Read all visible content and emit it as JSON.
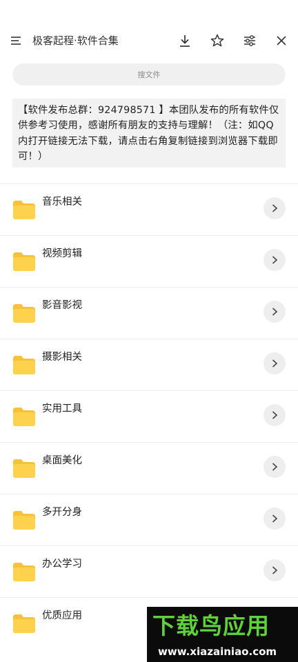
{
  "header": {
    "title": "极客起程·软件合集",
    "icons": {
      "menu": "menu-icon",
      "download": "download-icon",
      "favorite": "star-icon",
      "settings": "sliders-icon",
      "close": "close-icon"
    }
  },
  "search": {
    "placeholder": "搜文件"
  },
  "notice": {
    "text": "【软件发布总群：924798571 】本团队发布的所有软件仅供参考习使用，感谢所有朋友的支持与理解！（注：如QQ内打开链接无法下载，请点击右角复制链接到浏览器下载即可！）"
  },
  "folders": [
    {
      "label": "音乐相关",
      "icon": "folder-icon"
    },
    {
      "label": "视频剪辑",
      "icon": "folder-icon"
    },
    {
      "label": "影音影视",
      "icon": "folder-icon"
    },
    {
      "label": "摄影相关",
      "icon": "folder-icon"
    },
    {
      "label": "实用工具",
      "icon": "folder-icon"
    },
    {
      "label": "桌面美化",
      "icon": "folder-icon"
    },
    {
      "label": "多开分身",
      "icon": "folder-icon"
    },
    {
      "label": "办公学习",
      "icon": "folder-icon"
    },
    {
      "label": "优质应用",
      "icon": "folder-icon"
    }
  ],
  "watermark": {
    "brand": "下载鸟应用",
    "url": "www.xiazainiao.com"
  },
  "colors": {
    "folder": "#ffd24d",
    "folder_tab": "#f7c23a",
    "chevron_bg": "#eeeeee",
    "search_bg": "#f0f0f0",
    "notice_bg": "#f2f2f2",
    "watermark_green": "#5fd23a"
  }
}
